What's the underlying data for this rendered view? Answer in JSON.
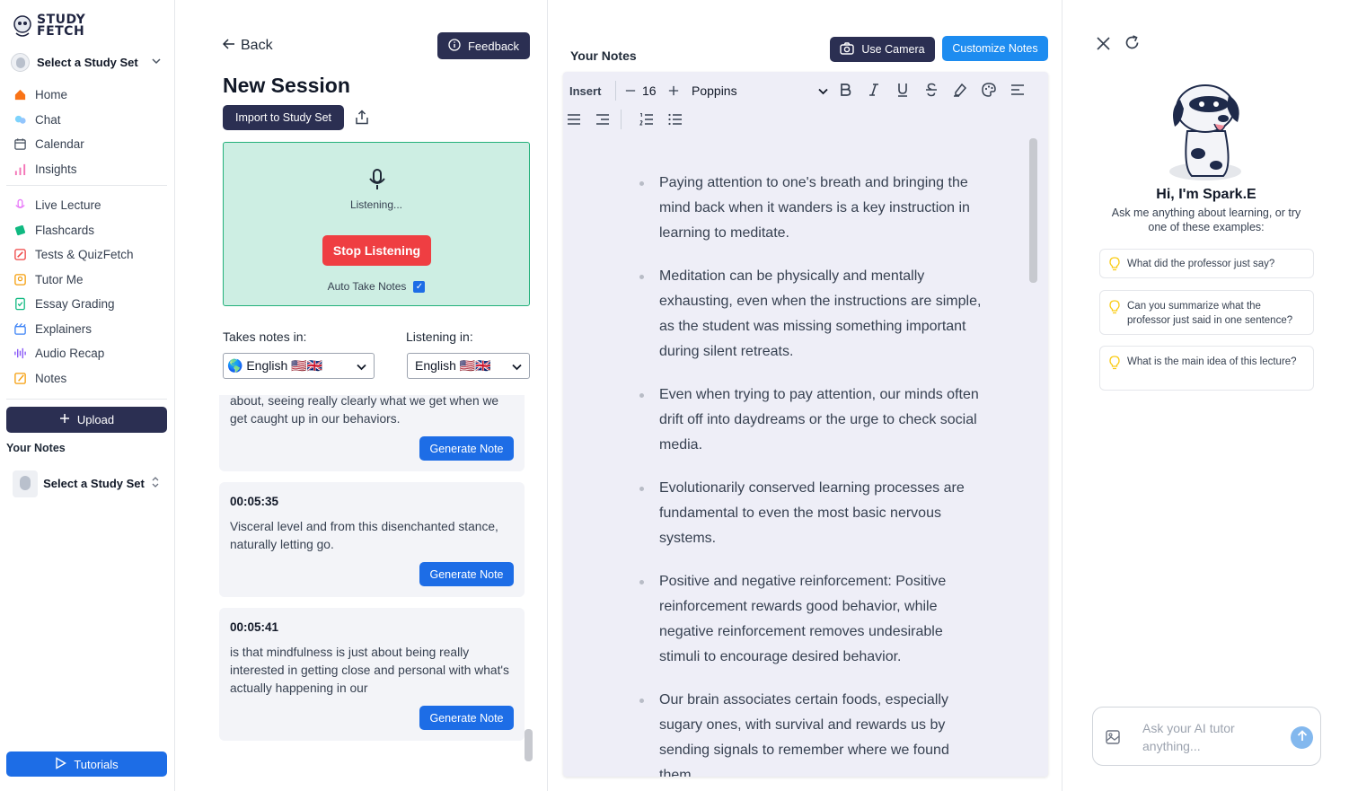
{
  "brand": {
    "logo_line1": "STUDY",
    "logo_line2": "FETCH"
  },
  "sidebar": {
    "study_set_select": "Select a Study Set",
    "nav_primary": [
      {
        "label": "Home",
        "icon": "home-icon"
      },
      {
        "label": "Chat",
        "icon": "chat-icon"
      },
      {
        "label": "Calendar",
        "icon": "calendar-icon"
      },
      {
        "label": "Insights",
        "icon": "insights-icon"
      }
    ],
    "nav_tools": [
      {
        "label": "Live Lecture",
        "icon": "microphone-icon"
      },
      {
        "label": "Flashcards",
        "icon": "flashcards-icon"
      },
      {
        "label": "Tests & QuizFetch",
        "icon": "pencil-icon"
      },
      {
        "label": "Tutor Me",
        "icon": "tutor-icon"
      },
      {
        "label": "Essay Grading",
        "icon": "essay-icon"
      },
      {
        "label": "Explainers",
        "icon": "explainers-icon"
      },
      {
        "label": "Audio Recap",
        "icon": "audio-wave-icon"
      },
      {
        "label": "Notes",
        "icon": "notes-icon"
      }
    ],
    "upload_label": "Upload",
    "your_notes_label": "Your Notes",
    "notes_study_set": "Select a Study Set",
    "tutorials_label": "Tutorials"
  },
  "session": {
    "back_label": "Back",
    "feedback_label": "Feedback",
    "title": "New Session",
    "import_label": "Import to Study Set",
    "listening_status": "Listening...",
    "stop_label": "Stop Listening",
    "auto_take_notes_label": "Auto Take Notes",
    "auto_take_notes_checked": true,
    "takes_notes_label": "Takes notes in:",
    "takes_notes_value": "🌎 English 🇺🇸🇬🇧",
    "listening_in_label": "Listening in:",
    "listening_in_value": "English 🇺🇸🇬🇧",
    "generate_label": "Generate Note",
    "transcript": [
      {
        "time": "",
        "text": "about, seeing really clearly what we get when we get caught up in our behaviors."
      },
      {
        "time": "00:05:35",
        "text": "Visceral level and from this disenchanted stance, naturally letting go."
      },
      {
        "time": "00:05:41",
        "text": "is that mindfulness is just about being really interested in getting close and personal with what's actually happening in our"
      }
    ]
  },
  "notes": {
    "title": "Your Notes",
    "use_camera_label": "Use Camera",
    "customize_label": "Customize Notes",
    "toolbar": {
      "insert_label": "Insert",
      "font_size": "16",
      "font_family": "Poppins"
    },
    "bullets": [
      "Paying attention to one's breath and bringing the mind back when it wanders is a key instruction in learning to meditate.",
      " Meditation can be physically and mentally exhausting, even when the instructions are simple, as the student was missing something important during silent retreats.",
      " Even when trying to pay attention, our minds often drift off into daydreams or the urge to check social media.",
      " Evolutionarily conserved learning processes are fundamental to even the most basic nervous systems.",
      " Positive and negative reinforcement: Positive reinforcement rewards good behavior, while negative reinforcement removes undesirable stimuli to encourage desired behavior.",
      " Our brain associates certain foods, especially sugary ones, with survival and rewards us by sending signals to remember where we found them."
    ]
  },
  "spark": {
    "greeting": "Hi, I'm Spark.E",
    "subtitle": "Ask me anything about learning, or try one of these examples:",
    "examples": [
      "What did the professor just say?",
      "Can you summarize what the professor just said in one sentence?",
      "What is the main idea of this lecture?"
    ],
    "input_placeholder": "Ask your AI tutor anything..."
  },
  "colors": {
    "navy": "#2b2f52",
    "blue": "#1d6de6",
    "red": "#ef3e42",
    "listen_bg": "#cdeee3",
    "listen_border": "#22b07a",
    "editor_bg": "#eeeef7"
  }
}
